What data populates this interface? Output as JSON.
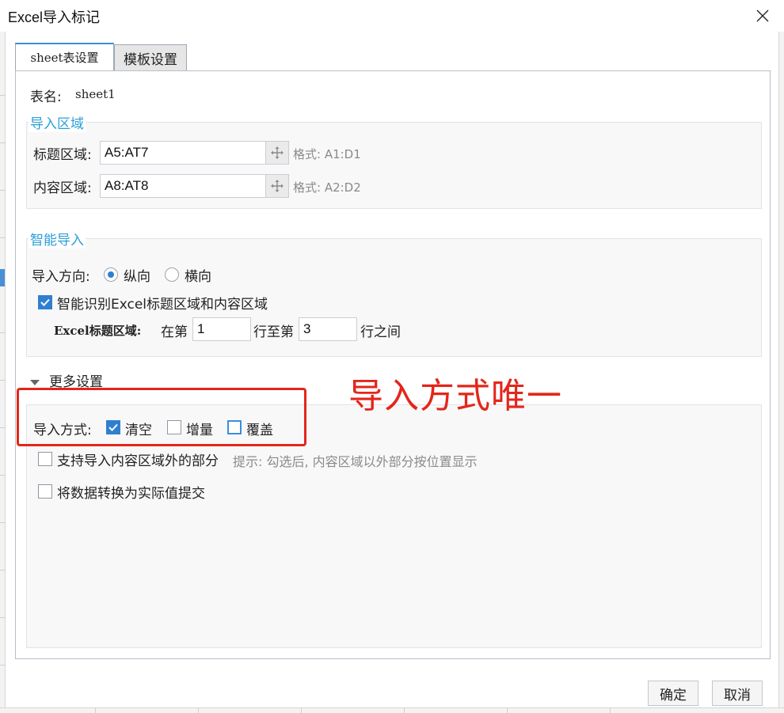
{
  "window": {
    "title": "Excel导入标记"
  },
  "tabs": [
    {
      "label": "sheet表设置",
      "active": true
    },
    {
      "label": "模板设置",
      "active": false
    }
  ],
  "sheet": {
    "name_label": "表名:",
    "name_value": "sheet1"
  },
  "import_area": {
    "title": "导入区域",
    "title_label": "标题区域:",
    "title_value": "A5:AT7",
    "title_format": "格式: A1:D1",
    "content_label": "内容区域:",
    "content_value": "A8:AT8",
    "content_format": "格式: A2:D2"
  },
  "smart_import": {
    "title": "智能导入",
    "direction_label": "导入方向:",
    "direction_options": [
      {
        "label": "纵向",
        "checked": true
      },
      {
        "label": "横向",
        "checked": false
      }
    ],
    "auto_detect_label": "智能识别Excel标题区域和内容区域",
    "auto_detect_checked": true,
    "range_label": "Excel标题区域:",
    "range_prefix": "在第",
    "range_from": "1",
    "range_mid": "行至第",
    "range_to": "3",
    "range_suffix": "行之间"
  },
  "more_settings": {
    "title": "更多设置",
    "mode_label": "导入方式:",
    "modes": [
      {
        "label": "清空",
        "checked": true
      },
      {
        "label": "增量",
        "checked": false
      },
      {
        "label": "覆盖",
        "checked": false
      }
    ],
    "outside_label": "支持导入内容区域外的部分",
    "outside_hint": "提示: 勾选后, 内容区域以外部分按位置显示",
    "outside_checked": false,
    "convert_label": "将数据转换为实际值提交",
    "convert_checked": false
  },
  "annotation": {
    "text": "导入方式唯一",
    "color": "#e3261b"
  },
  "footer": {
    "ok_label": "确定",
    "cancel_label": "取消"
  },
  "colors": {
    "accent": "#2f7fd0",
    "group_title": "#2b9fd8",
    "annotation": "#e3261b"
  },
  "icons": {
    "close": "close-icon",
    "move": "move-arrows-icon",
    "expand": "triangle-down-icon",
    "check": "checkmark-icon"
  }
}
